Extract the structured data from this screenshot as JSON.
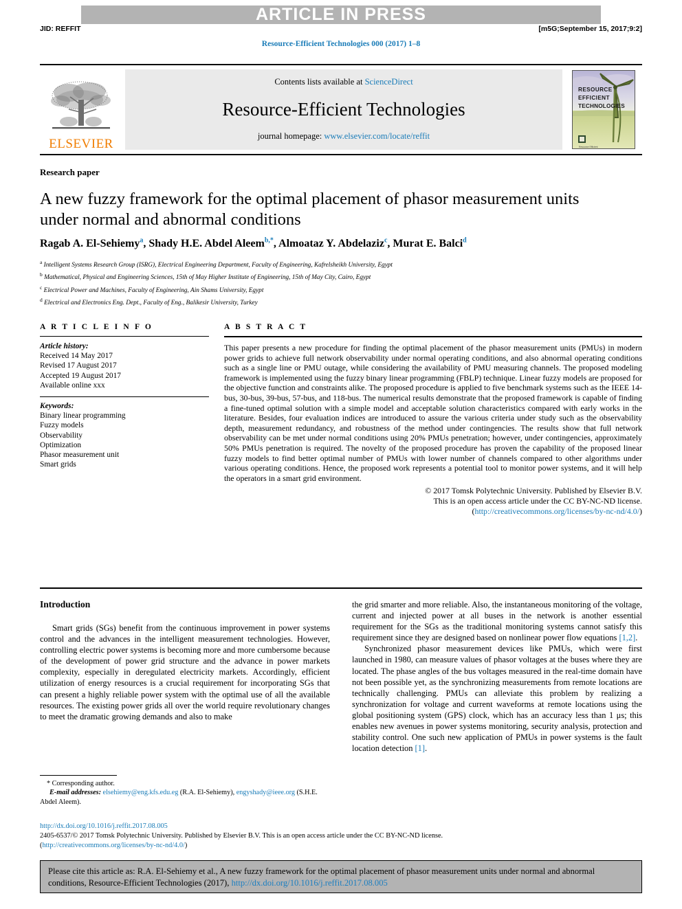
{
  "banner": {
    "text": "ARTICLE IN PRESS"
  },
  "runhead": {
    "jid": "JID: REFFIT",
    "stamp": "[m5G;September 15, 2017;9:2]"
  },
  "journal_ref": "Resource-Efficient Technologies 000 (2017) 1–8",
  "masthead": {
    "contents_prefix": "Contents lists available at ",
    "contents_link": "ScienceDirect",
    "journal_title": "Resource-Efficient Technologies",
    "homepage_prefix": "journal homepage: ",
    "homepage_link": "www.elsevier.com/locate/reffit",
    "publisher_wordmark": "ELSEVIER",
    "cover_lines": [
      "RESOURCE",
      "EFFICIENT",
      "TECHNOLOGIES"
    ]
  },
  "article": {
    "section_type": "Research paper",
    "title": "A new fuzzy framework for the optimal placement of phasor measurement units under normal and abnormal conditions",
    "authors": [
      {
        "name": "Ragab A. El-Sehiemy",
        "sup": "a",
        "sep": ", "
      },
      {
        "name": "Shady H.E. Abdel Aleem",
        "sup": "b,*",
        "sep": ", "
      },
      {
        "name": "Almoataz Y. Abdelaziz",
        "sup": "c",
        "sep": ", "
      },
      {
        "name": "Murat E. Balci",
        "sup": "d",
        "sep": ""
      }
    ],
    "affiliations": [
      {
        "sup": "a",
        "text": "Intelligent Systems Research Group (ISRG), Electrical Engineering Department, Faculty of Engineering, Kafrelsheikh University, Egypt"
      },
      {
        "sup": "b",
        "text": "Mathematical, Physical and Engineering Sciences, 15th of May Higher Institute of Engineering, 15th of May City, Cairo, Egypt"
      },
      {
        "sup": "c",
        "text": "Electrical Power and Machines, Faculty of Engineering, Ain Shams University, Egypt"
      },
      {
        "sup": "d",
        "text": "Electrical and Electronics Eng. Dept., Faculty of Eng., Balikesir University, Turkey"
      }
    ]
  },
  "article_info": {
    "heading": "A R T I C L E    I N F O",
    "history_label": "Article history:",
    "history": [
      "Received 14 May 2017",
      "Revised 17 August 2017",
      "Accepted 19 August 2017",
      "Available online xxx"
    ],
    "keywords_label": "Keywords:",
    "keywords": [
      "Binary linear programming",
      "Fuzzy models",
      "Observability",
      "Optimization",
      "Phasor measurement unit",
      "Smart grids"
    ]
  },
  "abstract": {
    "heading": "A B S T R A C T",
    "body": "This paper presents a new procedure for finding the optimal placement of the phasor measurement units (PMUs) in modern power grids to achieve full network observability under normal operating conditions, and also abnormal operating conditions such as a single line or PMU outage, while considering the availability of PMU measuring channels. The proposed modeling framework is implemented using the fuzzy binary linear programming (FBLP) technique. Linear fuzzy models are proposed for the objective function and constraints alike. The proposed procedure is applied to five benchmark systems such as the IEEE 14-bus, 30-bus, 39-bus, 57-bus, and 118-bus. The numerical results demonstrate that the proposed framework is capable of finding a fine-tuned optimal solution with a simple model and acceptable solution characteristics compared with early works in the literature. Besides, four evaluation indices are introduced to assure the various criteria under study such as the observability depth, measurement redundancy, and robustness of the method under contingencies. The results show that full network observability can be met under normal conditions using 20% PMUs penetration; however, under contingencies, approximately 50% PMUs penetration is required. The novelty of the proposed procedure has proven the capability of the proposed linear fuzzy models to find better optimal number of PMUs with lower number of channels compared to other algorithms under various operating conditions. Hence, the proposed work represents a potential tool to monitor power systems, and it will help the operators in a smart grid environment.",
    "copyright_line1": "© 2017 Tomsk Polytechnic University. Published by Elsevier B.V.",
    "copyright_line2": "This is an open access article under the CC BY-NC-ND license.",
    "copyright_link_open": "(",
    "copyright_link": "http://creativecommons.org/licenses/by-nc-nd/4.0/",
    "copyright_link_close": ")"
  },
  "introduction": {
    "heading": "Introduction",
    "left_paragraph": "Smart grids (SGs) benefit from the continuous improvement in power systems control and the advances in the intelligent measurement technologies. However, controlling electric power systems is becoming more and more cumbersome because of the development of power grid structure and the advance in power markets complexity, especially in deregulated electricity markets. Accordingly, efficient utilization of energy resources is a crucial requirement for incorporating SGs that can present a highly reliable power system with the optimal use of all the available resources. The existing power grids all over the world require revolutionary changes to meet the dramatic growing demands and also to make",
    "right_paragraph_1_a": "the grid smarter and more reliable. Also, the instantaneous monitoring of the voltage, current and injected power at all buses in the network is another essential requirement for the SGs as the traditional monitoring systems cannot satisfy this requirement since they are designed based on nonlinear power flow equations ",
    "right_paragraph_1_ref": "[1,2]",
    "right_paragraph_1_b": ".",
    "right_paragraph_2_a": "Synchronized phasor measurement devices like PMUs, which were first launched in 1980, can measure values of phasor voltages at the buses where they are located. The phase angles of the bus voltages measured in the real-time domain have not been possible yet, as the synchronizing measurements from remote locations are technically challenging. PMUs can alleviate this problem by realizing a synchronization for voltage and current waveforms at remote locations using the global positioning system (GPS) clock, which has an accuracy less than 1 μs; this enables new avenues in power systems monitoring, security analysis, protection and stability control. One such new application of PMUs in power systems is the fault location detection ",
    "right_paragraph_2_ref": "[1]",
    "right_paragraph_2_b": "."
  },
  "footnote": {
    "corresponding": "* Corresponding author.",
    "email_label": "E-mail addresses:",
    "email_1": "elsehiemy@eng.kfs.edu.eg",
    "name_1": "(R.A. El-Sehiemy),",
    "email_2": "engyshady@ieee.org",
    "name_2": "(S.H.E. Abdel Aleem)."
  },
  "publisher_footer": {
    "doi": "http://dx.doi.org/10.1016/j.reffit.2017.08.005",
    "issn_line_a": "2405-6537/© 2017 Tomsk Polytechnic University. Published by Elsevier B.V. This is an open access article under the CC BY-NC-ND license.",
    "license_open": "(",
    "license_link": "http://creativecommons.org/licenses/by-nc-nd/4.0/",
    "license_close": ")"
  },
  "citation_box": {
    "text_a": "Please cite this article as: R.A. El-Sehiemy et al., A new fuzzy framework for the optimal placement of phasor measurement units under normal and abnormal conditions, Resource-Efficient Technologies (2017), ",
    "link": "http://dx.doi.org/10.1016/j.reffit.2017.08.005"
  },
  "colors": {
    "link": "#1a7cb8",
    "banner_bg": "#b3b3b3",
    "elsevier_orange": "#f07d00",
    "masthead_bg": "#eaeaea"
  }
}
